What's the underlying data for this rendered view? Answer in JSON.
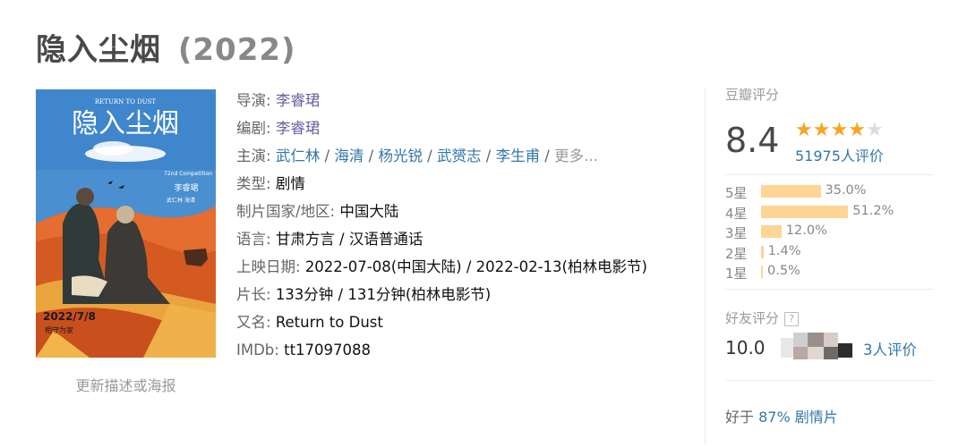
{
  "title": {
    "name": "隐入尘烟",
    "year": "(2022)"
  },
  "poster": {
    "english_title": "RETURN TO DUST",
    "chinese_title": "隐入尘烟",
    "badge": "72nd Competition",
    "director_credit": "李睿珺",
    "cast_credit": "武仁林  海清",
    "date": "2022/7/8",
    "tagline": "相守为家",
    "update_link": "更新描述或海报"
  },
  "info": {
    "director_label": "导演",
    "director": "李睿珺",
    "writer_label": "编剧",
    "writer": "李睿珺",
    "cast_label": "主演",
    "cast": [
      "武仁林",
      "海清",
      "杨光锐",
      "武赟志",
      "李生甫"
    ],
    "cast_more": "更多...",
    "genre_label": "类型:",
    "genre": "剧情",
    "country_label": "制片国家/地区:",
    "country": "中国大陆",
    "language_label": "语言:",
    "language": "甘肃方言 / 汉语普通话",
    "release_label": "上映日期:",
    "release": "2022-07-08(中国大陆) / 2022-02-13(柏林电影节)",
    "runtime_label": "片长:",
    "runtime": "133分钟 / 131分钟(柏林电影节)",
    "aka_label": "又名:",
    "aka": "Return to Dust",
    "imdb_label": "IMDb:",
    "imdb": "tt17097088"
  },
  "rating": {
    "header": "豆瓣评分",
    "score": "8.4",
    "stars_filled": 4,
    "stars_total": 5,
    "votes": "51975人评价",
    "distribution": [
      {
        "level": "5星",
        "percent": "35.0%",
        "value": 35.0
      },
      {
        "level": "4星",
        "percent": "51.2%",
        "value": 51.2
      },
      {
        "level": "3星",
        "percent": "12.0%",
        "value": 12.0
      },
      {
        "level": "2星",
        "percent": "1.4%",
        "value": 1.4
      },
      {
        "level": "1星",
        "percent": "0.5%",
        "value": 0.5
      }
    ],
    "friend_header": "好友评分",
    "friend_help": "?",
    "friend_score": "10.0",
    "friend_votes": "3人评价",
    "better_than_prefix": "好于",
    "better_than_value": "87%",
    "better_than_genre": "剧情片"
  },
  "colors": {
    "link": "#3377aa",
    "star": "#f5a623",
    "bar": "#ffd596",
    "title": "#494949"
  }
}
